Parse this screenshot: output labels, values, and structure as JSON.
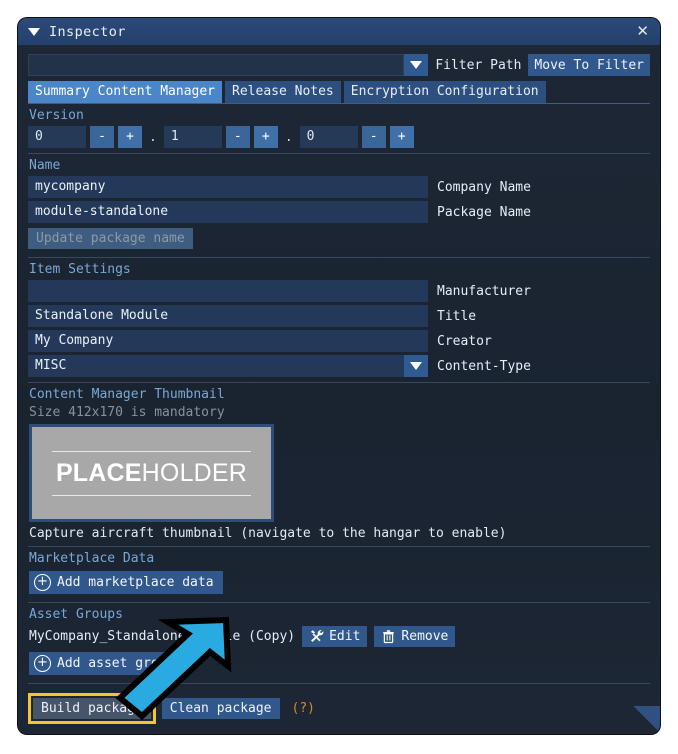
{
  "window": {
    "title": "Inspector",
    "collapse_icon": "triangle-down-icon",
    "close_icon": "close-icon"
  },
  "filter": {
    "path_value": "",
    "path_placeholder": "",
    "dropdown_icon": "chevron-down-icon",
    "label": "Filter Path",
    "move_button": "Move To Filter"
  },
  "tabs": [
    {
      "label": "Summary Content Manager",
      "active": true
    },
    {
      "label": "Release Notes",
      "active": false
    },
    {
      "label": "Encryption Configuration",
      "active": false
    }
  ],
  "version": {
    "label": "Version",
    "major": "0",
    "minor": "1",
    "patch": "0",
    "minus": "-",
    "plus": "+",
    "dot": "."
  },
  "name_section": {
    "label": "Name",
    "company_value": "mycompany",
    "company_label": "Company Name",
    "package_value": "module-standalone",
    "package_label": "Package Name",
    "update_button": "Update package name"
  },
  "item_settings": {
    "label": "Item Settings",
    "manufacturer_value": "",
    "manufacturer_label": "Manufacturer",
    "title_value": "Standalone Module",
    "title_label": "Title",
    "creator_value": "My Company",
    "creator_label": "Creator",
    "content_type_value": "MISC",
    "content_type_label": "Content-Type",
    "content_type_icon": "chevron-down-icon"
  },
  "thumbnail": {
    "label": "Content Manager Thumbnail",
    "size_hint": "Size 412x170 is mandatory",
    "placeholder_bold": "PLACE",
    "placeholder_light": "HOLDER",
    "caption": "Capture aircraft thumbnail (navigate to the hangar to enable)"
  },
  "marketplace": {
    "label": "Marketplace Data",
    "add_button": "Add marketplace data",
    "add_icon": "circle-plus-icon"
  },
  "asset_groups": {
    "label": "Asset Groups",
    "item_name": "MyCompany_Standalone_Module (Copy)",
    "edit_button": "Edit",
    "edit_icon": "tools-icon",
    "remove_button": "Remove",
    "remove_icon": "trash-icon",
    "add_button": "Add asset group",
    "add_icon": "circle-plus-icon"
  },
  "footer": {
    "build_button": "Build package",
    "clean_button": "Clean package",
    "help": "(?)"
  },
  "annotation": {
    "arrow_color": "#29ABE2",
    "highlight_color": "#f5c431"
  }
}
